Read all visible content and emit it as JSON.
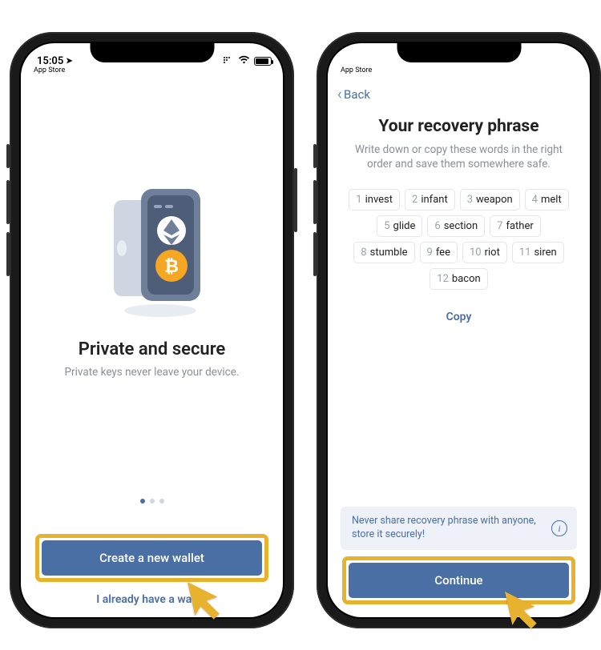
{
  "colors": {
    "accent": "#4a6fa5",
    "highlight": "#e7b32e",
    "muted": "#8a8f98"
  },
  "statusbar": {
    "time": "15:05",
    "breadcrumb": "App Store",
    "breadcrumb_right": "App Store"
  },
  "screen1": {
    "title": "Private and secure",
    "subtitle": "Private keys never leave your device.",
    "primary_cta": "Create a new wallet",
    "secondary_cta": "I already have a wallet",
    "page_index": 0,
    "page_count": 3
  },
  "screen2": {
    "back_label": "Back",
    "title": "Your recovery phrase",
    "subtitle": "Write down or copy these words in the right order and save them somewhere safe.",
    "words": [
      "invest",
      "infant",
      "weapon",
      "melt",
      "glide",
      "section",
      "father",
      "stumble",
      "fee",
      "riot",
      "siren",
      "bacon"
    ],
    "copy_label": "Copy",
    "notice": "Never share recovery phrase with anyone, store it securely!",
    "continue_label": "Continue"
  }
}
